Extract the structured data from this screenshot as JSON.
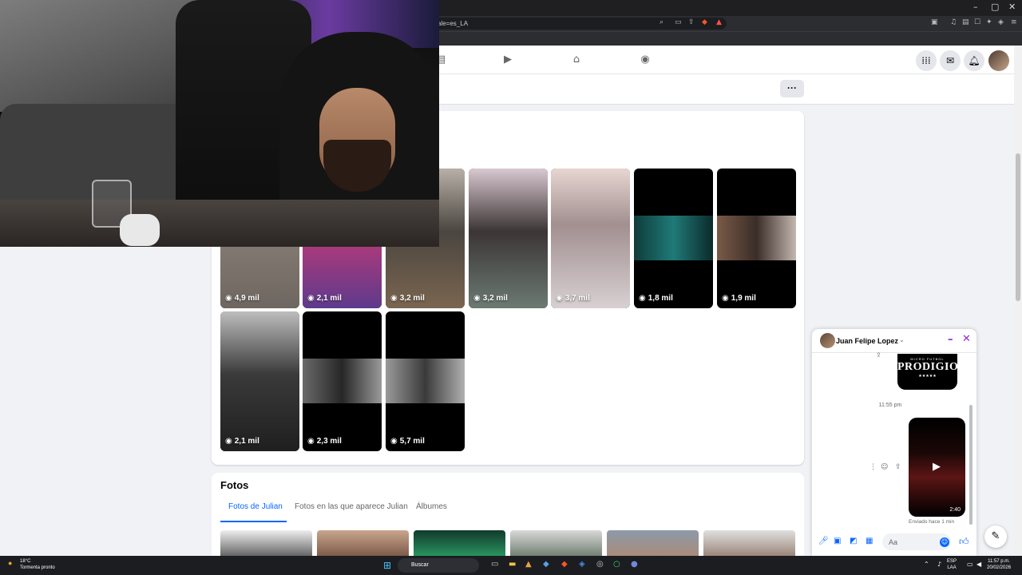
{
  "browser": {
    "url": "ale=es_LA",
    "window_controls": [
      "–",
      "▢",
      "✕"
    ]
  },
  "fb_nav": {
    "menu_icon": "grid-icon",
    "messenger_icon": "messenger-icon",
    "notifications_icon": "bell-icon"
  },
  "profile_strip": {
    "more_label": "···"
  },
  "reels": {
    "row1": [
      {
        "views": "4,9 mil"
      },
      {
        "views": "2,1 mil"
      },
      {
        "views": "3,2 mil"
      },
      {
        "views": "3,2 mil"
      },
      {
        "views": "3,7 mil"
      },
      {
        "views": "1,8 mil"
      },
      {
        "views": "1,9 mil"
      }
    ],
    "row2": [
      {
        "views": "2,1 mil"
      },
      {
        "views": "2,3 mil"
      },
      {
        "views": "5,7 mil"
      }
    ]
  },
  "photos": {
    "title": "Fotos",
    "tabs": [
      "Fotos de Julian",
      "Fotos en las que aparece Julian",
      "Álbumes"
    ]
  },
  "chat": {
    "name": "Juan Felipe Lopez",
    "minimize": "–",
    "close": "✕",
    "prod_small": "MICRO FUTBOL",
    "prod_big": "PRODIGIOS",
    "prod_stars": "★★★★★",
    "time": "11:55 pm",
    "video_duration": "2:40",
    "sent_status": "Enviado hace 1 min",
    "input_placeholder": "Aa"
  },
  "taskbar": {
    "temp": "18°C",
    "weather": "Tormenta pronto",
    "search": "Buscar",
    "lang1": "ESP",
    "lang2": "LAA",
    "clock": "11:57 p.m.",
    "date": "20/02/2026"
  }
}
